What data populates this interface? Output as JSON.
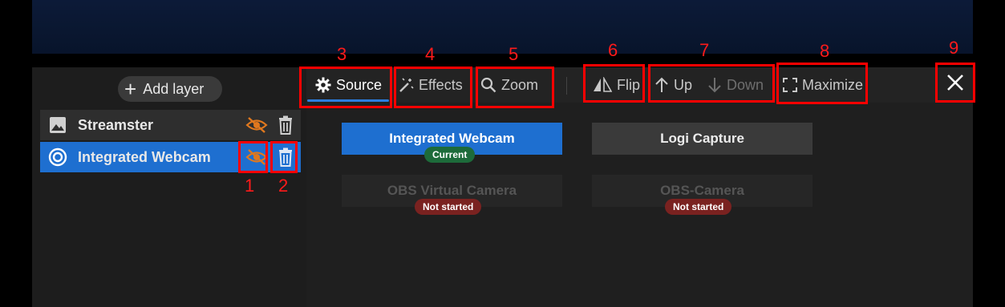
{
  "sidebar": {
    "add_layer_label": "Add layer",
    "layers": [
      {
        "name": "Streamster",
        "icon": "image-icon",
        "selected": false
      },
      {
        "name": "Integrated Webcam",
        "icon": "webcam-circle-icon",
        "selected": true
      }
    ]
  },
  "toolbar": {
    "tabs": [
      {
        "label": "Source",
        "icon": "gear-icon",
        "active": true
      },
      {
        "label": "Effects",
        "icon": "magic-wand-icon",
        "active": false
      },
      {
        "label": "Zoom",
        "icon": "search-icon",
        "active": false
      }
    ],
    "actions": [
      {
        "label": "Flip",
        "icon": "flip-icon",
        "enabled": true
      },
      {
        "label": "Up",
        "icon": "arrow-up-icon",
        "enabled": true
      },
      {
        "label": "Down",
        "icon": "arrow-down-icon",
        "enabled": false
      },
      {
        "label": "Maximize",
        "icon": "maximize-icon",
        "enabled": true
      }
    ],
    "close_icon": "close-icon"
  },
  "sources": [
    {
      "name": "Integrated Webcam",
      "status": "Current",
      "state": "selected"
    },
    {
      "name": "Logi Capture",
      "status": "",
      "state": "normal"
    },
    {
      "name": "OBS Virtual Camera",
      "status": "Not started",
      "state": "off"
    },
    {
      "name": "OBS-Camera",
      "status": "Not started",
      "state": "off"
    }
  ],
  "annotations": [
    "1",
    "2",
    "3",
    "4",
    "5",
    "6",
    "7",
    "8",
    "9"
  ],
  "colors": {
    "accent": "#1e6fd0",
    "hidden_eye": "#e0781e",
    "annotation": "#ff0000",
    "badge_current": "#1d6b3a",
    "badge_not_started": "#7a2220"
  }
}
